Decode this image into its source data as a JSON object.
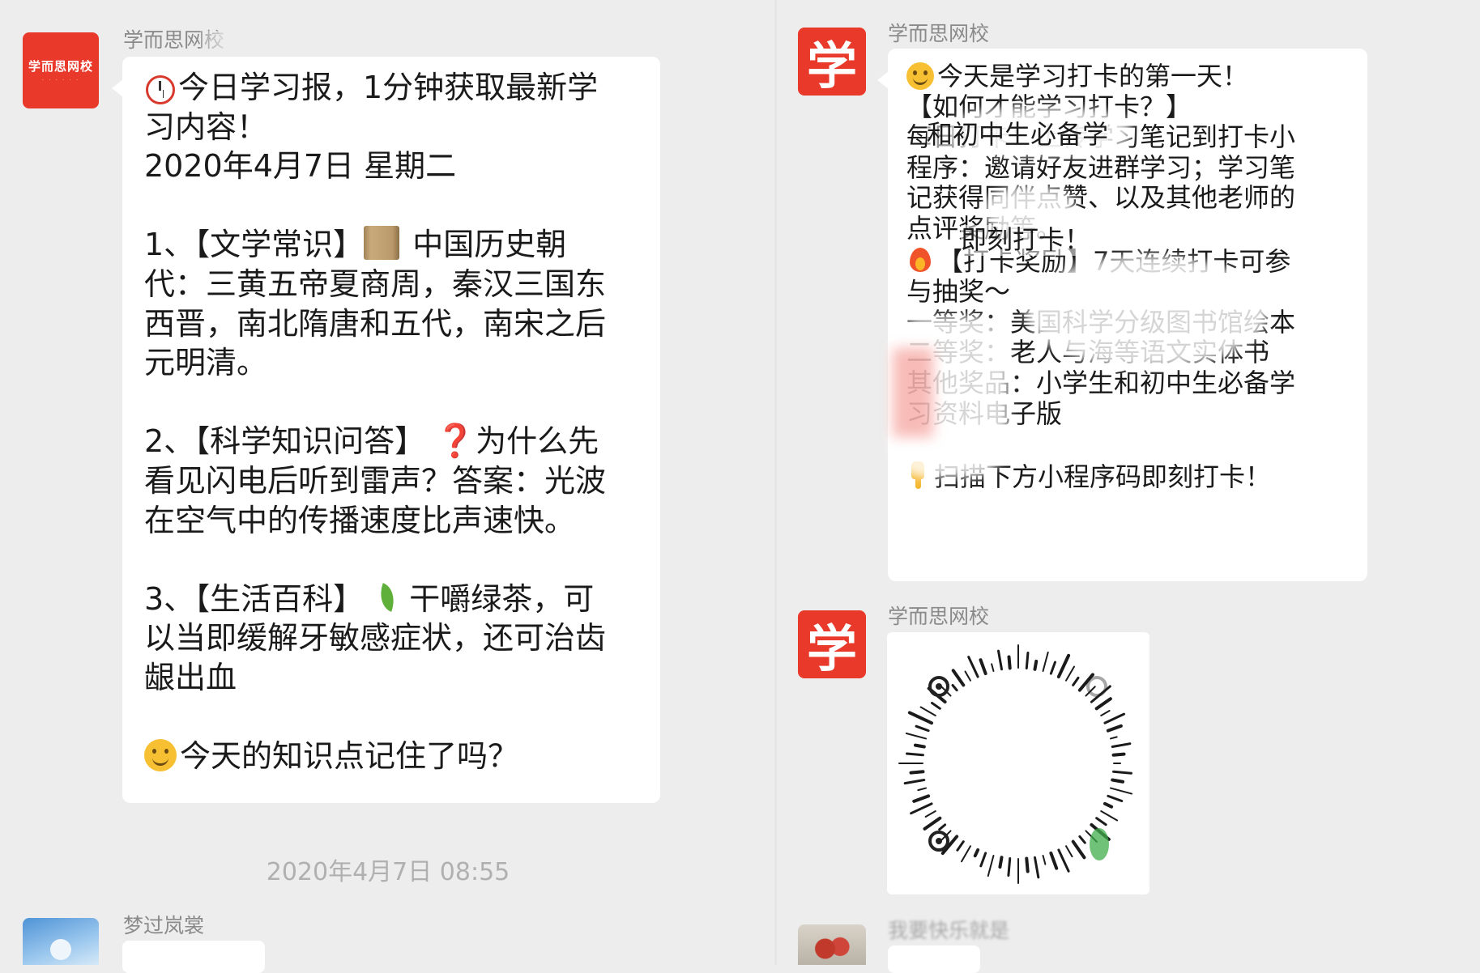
{
  "left_chat": {
    "message1": {
      "sender_name": "学而思网校",
      "avatar_logo_text": "学而思网校",
      "lines": {
        "l1": "今日学习报，1分钟获取最新学",
        "l2": "习内容！",
        "l3": "2020年4月7日 星期二",
        "l4a": "1、【文学常识】",
        "l4b": " 中国历史朝",
        "l5": "代：三黄五帝夏商周，秦汉三国东",
        "l6": "西晋，南北隋唐和五代，南宋之后",
        "l7": "元明清。",
        "l8a": "2、【科学知识问答】 ",
        "l8q": "❓",
        "l8b": "为什么先",
        "l9": "看见闪电后听到雷声？答案：光波",
        "l10": "在空气中的传播速度比声速快。",
        "l11a": "3、【生活百科】 ",
        "l11b": "干嚼绿茶，可",
        "l12": "以当即缓解牙敏感症状，还可治齿",
        "l13": "龈出血",
        "l14": "今天的知识点记住了吗？"
      }
    },
    "timestamp": "2020年4月7日 08:55",
    "message2": {
      "sender_name": "梦过岚裳"
    }
  },
  "right_chat": {
    "message1": {
      "sender_name": "学而思网校",
      "avatar_char": "学",
      "lines": {
        "r1": "今天是学习打卡的第一天！",
        "r2": "【如何才能学习打卡？】",
        "r3": "每日打卡：上传学习笔记到打卡小",
        "r4": "程序：邀请好友进群学习；学习笔",
        "r5": "记获得同伴点赞、以及其他老师的",
        "r6": "点评奖励等。",
        "r7": "【打卡奖励】7天连续打卡可参",
        "r8": "与抽奖～",
        "r9": "一等奖：美国科学分级图书馆绘本",
        "r10": "二等奖：老人与海等语文实体书",
        "r11": "其他奖品：小学生和初中生必备学",
        "r12": "习资料电子版",
        "r13": "扫描下方小程序码即刻打卡！",
        "overlay1": "和初中生必备学",
        "overlay2": "即刻打卡！"
      }
    },
    "message2": {
      "sender_name": "学而思网校",
      "avatar_char": "学"
    },
    "message3": {
      "sender_name": "我要快乐就是"
    }
  },
  "colors": {
    "background": "#ededed",
    "bubble": "#ffffff",
    "brand_red": "#e8392a",
    "sender_text": "#8a8a8a",
    "timestamp_text": "#b0b0b0"
  },
  "icons": [
    "alarm-clock-icon",
    "scroll-icon",
    "red-question-icon",
    "leaf-icon",
    "smile-icon",
    "fire-icon",
    "pointing-down-icon",
    "mini-program-code-icon"
  ]
}
